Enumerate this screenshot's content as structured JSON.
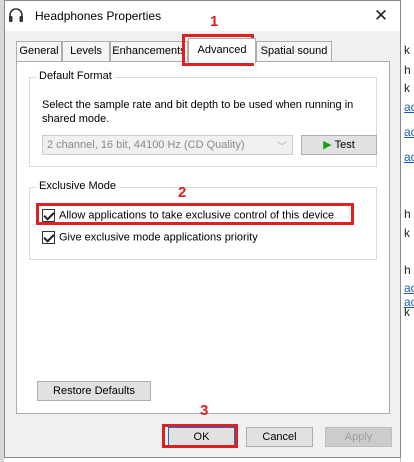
{
  "window": {
    "title": "Headphones Properties"
  },
  "tabs": [
    {
      "label": "General"
    },
    {
      "label": "Levels"
    },
    {
      "label": "Enhancements"
    },
    {
      "label": "Advanced",
      "active": true
    },
    {
      "label": "Spatial sound"
    }
  ],
  "default_format": {
    "title": "Default Format",
    "description": "Select the sample rate and bit depth to be used when running in shared mode.",
    "selected_format": "2 channel, 16 bit, 44100 Hz (CD Quality)",
    "test_label": "Test"
  },
  "exclusive_mode": {
    "title": "Exclusive Mode",
    "options": [
      {
        "label": "Allow applications to take exclusive control of this device",
        "checked": true
      },
      {
        "label": "Give exclusive mode applications priority",
        "checked": true
      }
    ]
  },
  "buttons": {
    "restore_defaults": "Restore Defaults",
    "ok": "OK",
    "cancel": "Cancel",
    "apply": "Apply"
  },
  "annotations": [
    "1",
    "2",
    "3"
  ],
  "background_glyphs": [
    "k",
    "h",
    "k",
    "ac",
    "ac",
    "ac",
    "h",
    "k",
    "h",
    "ac",
    "ac",
    "k"
  ],
  "colors": {
    "annotation": "#e02020",
    "dialog_bg": "#f0f0f0",
    "primary_border": "#0078d7",
    "play_icon": "#1aa31a"
  }
}
